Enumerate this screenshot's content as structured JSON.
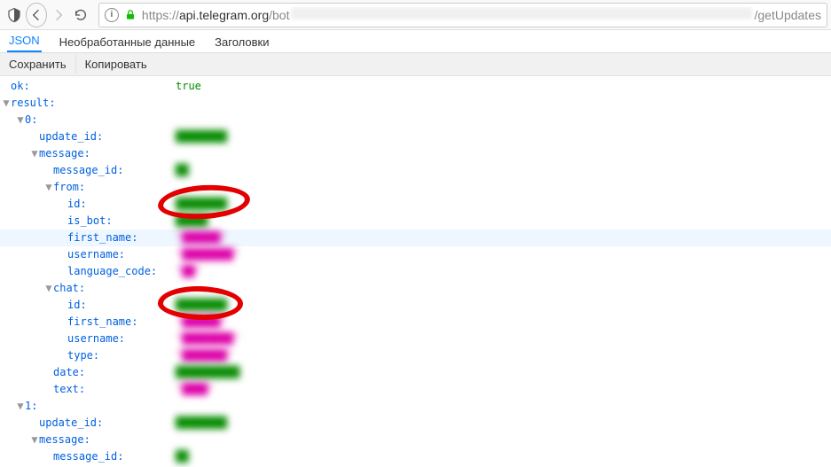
{
  "toolbar": {
    "url_scheme": "https://",
    "url_domain": "api.telegram.org",
    "url_path_prefix": "/bot",
    "url_path_suffix": "/getUpdates"
  },
  "tabs": {
    "json": "JSON",
    "raw": "Необработанные данные",
    "headers": "Заголовки"
  },
  "actions": {
    "save": "Сохранить",
    "copy": "Копировать"
  },
  "json_tree": {
    "ok_key": "ok",
    "ok_val": "true",
    "result_key": "result",
    "items": [
      {
        "idx": "0",
        "update_id_key": "update_id",
        "update_id_val": "████████",
        "message_key": "message",
        "message_id_key": "message_id",
        "message_id_val": "██",
        "from_key": "from",
        "from": {
          "id_key": "id",
          "id_val": "████████",
          "is_bot_key": "is_bot",
          "is_bot_val": "█████",
          "first_name_key": "first_name",
          "first_name_val": "\"██████\"",
          "username_key": "username",
          "username_val": "\"████████\"",
          "language_code_key": "language_code",
          "language_code_val": "\"██\""
        },
        "chat_key": "chat",
        "chat": {
          "id_key": "id",
          "id_val": "████████",
          "first_name_key": "first_name",
          "first_name_val": "\"██████\"",
          "username_key": "username",
          "username_val": "\"████████\"",
          "type_key": "type",
          "type_val": "\"███████\""
        },
        "date_key": "date",
        "date_val": "██████████",
        "text_key": "text",
        "text_val": "\"████\""
      },
      {
        "idx": "1",
        "update_id_key": "update_id",
        "update_id_val": "████████",
        "message_key": "message",
        "message_id_key": "message_id",
        "message_id_val": "██"
      }
    ]
  }
}
